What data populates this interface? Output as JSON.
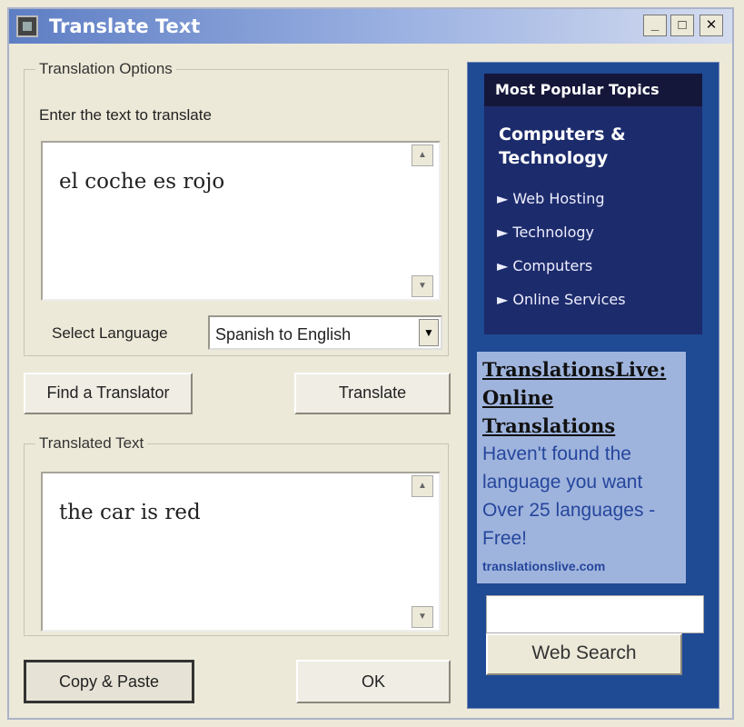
{
  "window": {
    "title": "Translate Text",
    "minimize": "_",
    "maximize": "□",
    "close": "✕"
  },
  "options": {
    "group_title": "Translation Options",
    "input_label": "Enter the text to translate",
    "input_text": "el coche es rojo",
    "language_label": "Select Language",
    "language_value": "Spanish to English"
  },
  "buttons": {
    "find_translator": "Find a Translator",
    "translate": "Translate",
    "copy_paste": "Copy & Paste",
    "ok": "OK"
  },
  "output": {
    "group_title": "Translated Text",
    "text": "the car is red"
  },
  "sidebar": {
    "header": "Most Popular Topics",
    "category": "Computers & Technology",
    "topics": [
      "Web Hosting",
      "Technology",
      "Computers",
      "Online Services"
    ],
    "ad": {
      "title": "TranslationsLive: Online Translations",
      "body": "Haven't found the language you want Over 25 languages - Free!",
      "url": "translationslive.com"
    },
    "search_value": "",
    "search_button": "Web Search"
  },
  "colors": {
    "sidebar_bg": "#1f4a94",
    "topics_bg": "#1c2b6b",
    "ad_bg": "#9fb4dd"
  }
}
